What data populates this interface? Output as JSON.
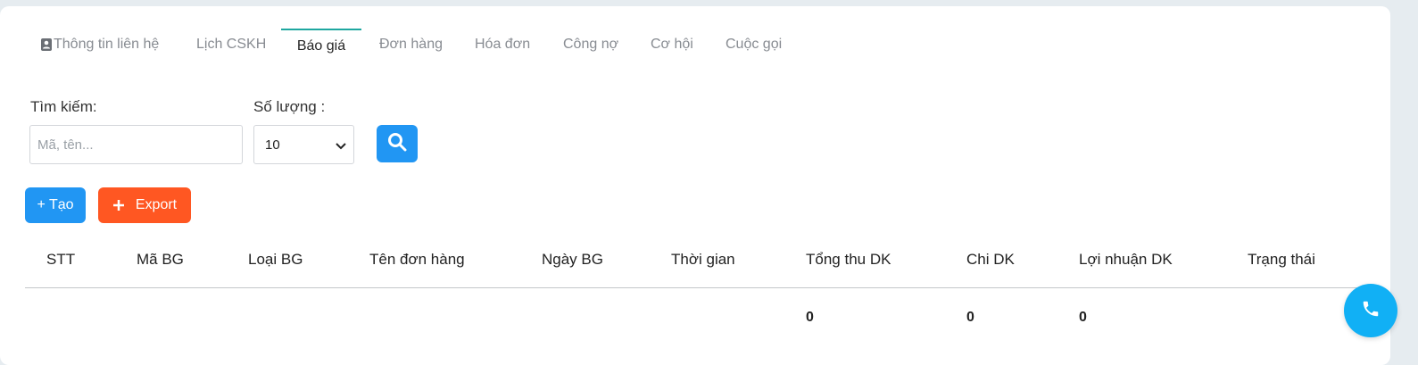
{
  "tabs": [
    {
      "label": "Thông tin liên hệ",
      "active": false
    },
    {
      "label": "Lịch CSKH",
      "active": false
    },
    {
      "label": "Báo giá",
      "active": true
    },
    {
      "label": "Đơn hàng",
      "active": false
    },
    {
      "label": "Hóa đơn",
      "active": false
    },
    {
      "label": "Công nợ",
      "active": false
    },
    {
      "label": "Cơ hội",
      "active": false
    },
    {
      "label": "Cuộc gọi",
      "active": false
    }
  ],
  "filters": {
    "search_label": "Tìm kiếm:",
    "search_placeholder": "Mã, tên...",
    "search_value": "",
    "quantity_label": "Số lượng :",
    "quantity_value": "10"
  },
  "actions": {
    "create_label": "+ Tạo",
    "export_label": "Export"
  },
  "table": {
    "headers": [
      "STT",
      "Mã BG",
      "Loại BG",
      "Tên đơn hàng",
      "Ngày BG",
      "Thời gian",
      "Tổng thu DK",
      "Chi DK",
      "Lợi nhuận DK",
      "Trạng thái"
    ],
    "totals": {
      "revenue": "0",
      "cost": "0",
      "profit": "0"
    }
  },
  "colors": {
    "primary": "#2196f3",
    "export": "#ff5722",
    "active_tab": "#1fa7a0",
    "call_button": "#11b0f5"
  },
  "icons": {
    "contact_tab": "contact-card-icon",
    "search_button": "search-icon",
    "export": "plus-icon",
    "call": "phone-icon",
    "select": "chevron-down-icon"
  }
}
